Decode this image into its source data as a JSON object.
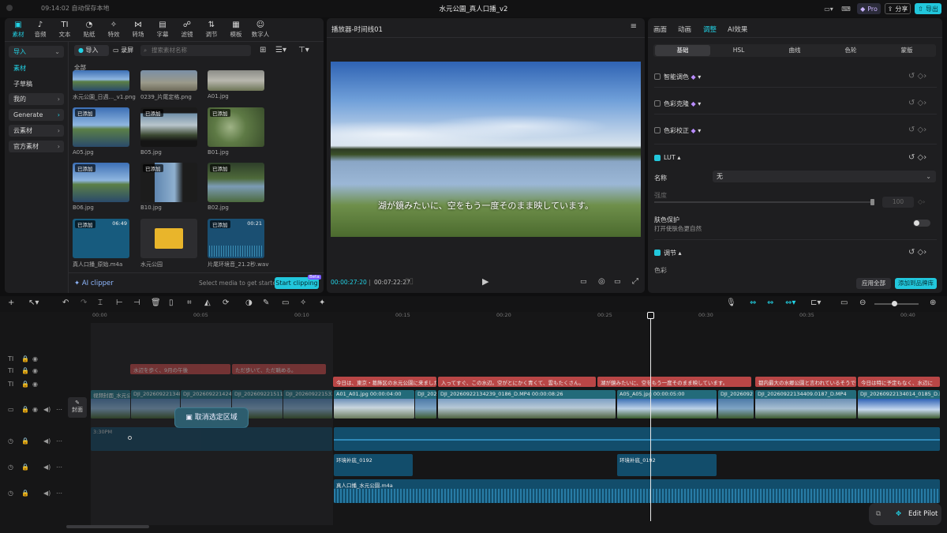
{
  "titlebar": {
    "autosave": "09:14:02 自动保存本地",
    "title": "水元公園_真人口播_v2",
    "pro": "Pro",
    "share": "分享",
    "export": "导出"
  },
  "toolbar": [
    "素材",
    "音频",
    "文本",
    "贴纸",
    "特效",
    "转场",
    "字幕",
    "滤镜",
    "调节",
    "模板",
    "数字人"
  ],
  "sidebar": {
    "import": "导入",
    "items": [
      "素材",
      "子草稿",
      "我的",
      "Generate",
      "云素材",
      "官方素材"
    ]
  },
  "media": {
    "import_btn": "导入",
    "record_btn": "录屏",
    "search_placeholder": "搜索素材名称",
    "all_label": "全部",
    "items": [
      {
        "name": "水元公園_日週..._v1.png",
        "badge": ""
      },
      {
        "name": "0239_片尾定格.png",
        "badge": ""
      },
      {
        "name": "A01.jpg",
        "badge": ""
      },
      {
        "name": "A05.jpg",
        "badge": "已添加"
      },
      {
        "name": "B05.jpg",
        "badge": "已添加"
      },
      {
        "name": "B01.jpg",
        "badge": "已添加"
      },
      {
        "name": "B06.jpg",
        "badge": "已添加"
      },
      {
        "name": "B10.jpg",
        "badge": "已添加"
      },
      {
        "name": "B02.jpg",
        "badge": "已添加"
      },
      {
        "name": "真人口播_原始.m4a",
        "badge": "已添加",
        "duration": "06:49"
      },
      {
        "name": "水元公园",
        "badge": ""
      },
      {
        "name": "片尾环境音_21.2秒.wav",
        "badge": "已添加",
        "duration": "00:21"
      }
    ],
    "ai_clipper": "AI clipper",
    "select_hint": "Select media to get started",
    "start_clipping": "Start clipping",
    "beta": "Beta"
  },
  "player": {
    "title": "播放器-时间线01",
    "subtitle": "湖が鏡みたいに、空をもう一度そのまま映しています。",
    "current_time": "00:00:27:20",
    "total_time": "00:07:22:27"
  },
  "inspector": {
    "tabs": [
      "画面",
      "动画",
      "调整",
      "AI效果"
    ],
    "subtabs": [
      "基础",
      "HSL",
      "曲线",
      "色轮",
      "蒙版"
    ],
    "smart_color": "智能调色",
    "color_match": "色彩克隆",
    "color_correct": "色彩校正",
    "lut": "LUT",
    "name_label": "名称",
    "name_value": "无",
    "strength_label": "强度",
    "strength_value": "100",
    "skin_protect": "肤色保护",
    "skin_desc": "打开使肤色更自然",
    "adjust": "调节",
    "color": "色彩",
    "apply_all": "应用全部",
    "add_preset": "添加到品牌库"
  },
  "timeline": {
    "ruler": [
      "00:00",
      "00:05",
      "00:10",
      "00:15",
      "00:20",
      "00:25",
      "00:30",
      "00:35",
      "00:40"
    ],
    "cover": "封面",
    "deselect": "取消选定区域",
    "subtitle_clips": [
      "水辺を歩く、9月の午後",
      "ただ歩いて、ただ眺める。",
      "今日は、東京・葛飾区の水元公園に来ました",
      "入ってすぐ、この水辺。空がとにかく青くて、雲もたくさん。",
      "湖が鏡みたいに、空をもう一度そのまま映しています。",
      "都内最大の水郷公園と言われているそうです",
      "今日は特に予定もなく、水辺に"
    ],
    "video_clips": [
      "视频封面_水元公",
      "DJI_20260922134821",
      "DJI_20260922142419",
      "DJI_20260922151126",
      "DJI_20260922153364",
      "A01_A01.jpg 00:00:04:00",
      "DJI_2026",
      "DJI_20260922134239_0186_D.MP4 00:00:08:26",
      "A05_A05.jpg 00:00:05:00",
      "DJI_2026092",
      "DJI_20260922134409.0187_D.MP4",
      "DJI_20260922134014_0185_D.MP4"
    ],
    "audio_time": "3:30PM",
    "ambient_clips": [
      "环境补底_0192",
      "环境补底_0192"
    ],
    "voice_clip": "真人口播_水元公園.m4a",
    "edit_pilot": "Edit Pilot"
  }
}
